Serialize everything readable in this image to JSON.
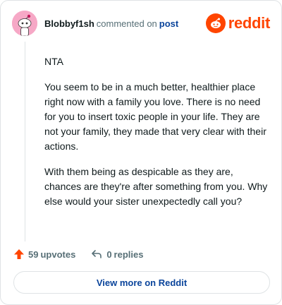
{
  "header": {
    "username": "Blobbyf1sh",
    "action_text": "commented on",
    "post_link": "post",
    "logo_text": "reddit"
  },
  "comment": {
    "paragraphs": [
      "NTA",
      "You seem to be in a much better, healthier place right now with a family you love. There is no need for you to insert toxic people in your life. They are not your family, they made that very clear with their actions.",
      "With them being as despicable as they are, chances are they're after something from you. Why else would your sister unexpectedly call you?"
    ]
  },
  "actions": {
    "upvote_count": "59",
    "upvote_label": "upvotes",
    "reply_count": "0",
    "reply_label": "replies"
  },
  "footer": {
    "view_more_label": "View more on Reddit"
  },
  "colors": {
    "brand": "#ff4500",
    "link": "#0a449b",
    "avatar_bg": "#f6a8c6",
    "muted": "#576f76"
  },
  "icons": [
    "snoo-avatar-icon",
    "reddit-logo-icon",
    "upvote-arrow-icon",
    "reply-arrow-icon"
  ]
}
